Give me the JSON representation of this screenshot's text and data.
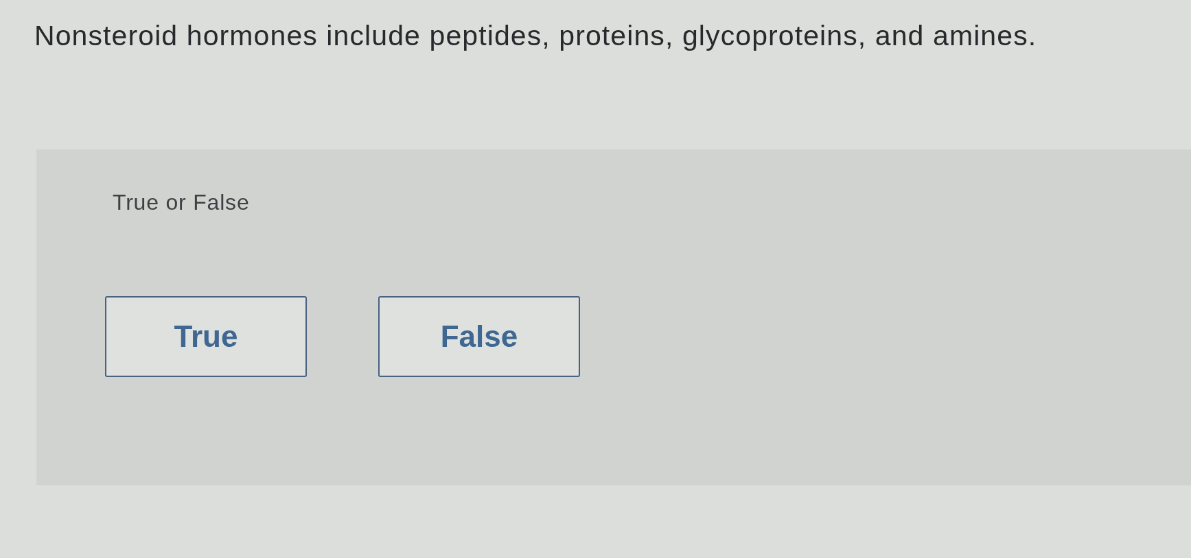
{
  "question": {
    "text": "Nonsteroid hormones include peptides, proteins, glycoproteins, and amines."
  },
  "answer_panel": {
    "prompt": "True or False",
    "options": [
      {
        "label": "True",
        "selected": false
      },
      {
        "label": "False",
        "selected": false
      }
    ]
  }
}
